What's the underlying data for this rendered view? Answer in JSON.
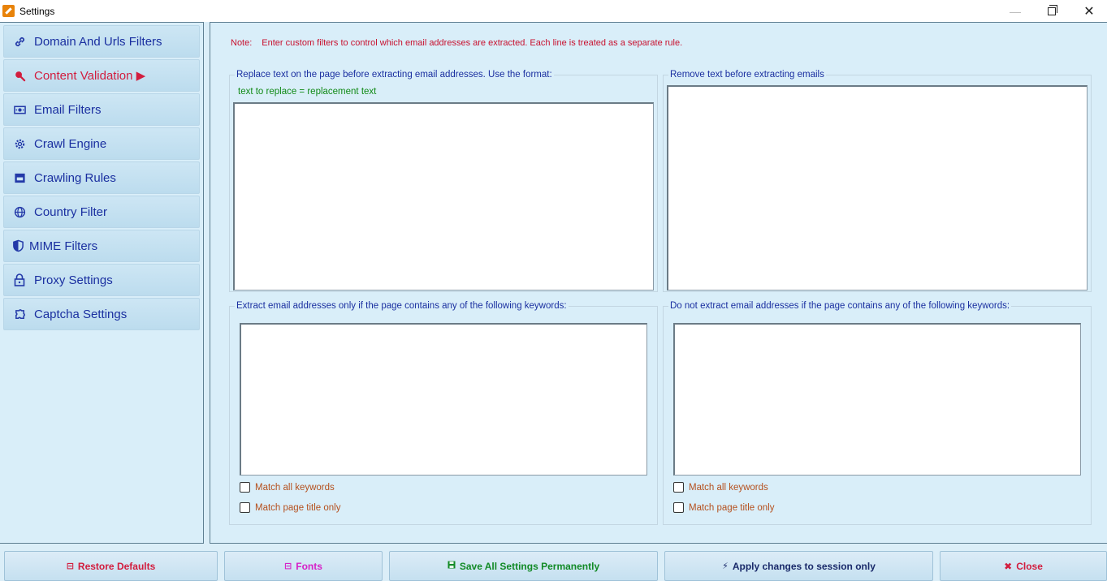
{
  "window": {
    "title": "Settings",
    "minimize_glyph": "—",
    "close_glyph": "✕"
  },
  "sidebar": {
    "items": [
      {
        "label": "Domain And Urls Filters",
        "icon": "link-icon",
        "glyph": "🔗"
      },
      {
        "label": "Content Validation ▶",
        "icon": "search-icon",
        "glyph": "🔍",
        "active": true
      },
      {
        "label": "Email Filters",
        "icon": "email-filter-icon",
        "glyph": "✉"
      },
      {
        "label": "Crawl Engine",
        "icon": "gear-icon",
        "glyph": "⚙"
      },
      {
        "label": "Crawling Rules",
        "icon": "rules-icon",
        "glyph": "▣"
      },
      {
        "label": "Country Filter",
        "icon": "globe-icon",
        "glyph": "🌐"
      },
      {
        "label": "MIME Filters",
        "icon": "shield-icon",
        "glyph": "◐"
      },
      {
        "label": "Proxy Settings",
        "icon": "lock-icon",
        "glyph": "🔒"
      },
      {
        "label": "Captcha Settings",
        "icon": "puzzle-icon",
        "glyph": "✱"
      }
    ]
  },
  "main": {
    "note_label": "Note:",
    "note_text": "Enter custom filters to control which email addresses are extracted. Each line is treated as a separate rule.",
    "replace_group": {
      "title": "Replace text on the page before extracting email addresses. Use the format:",
      "format_hint": "text to replace = replacement text",
      "value": ""
    },
    "remove_group": {
      "title": "Remove text before extracting emails",
      "value": ""
    },
    "include_group": {
      "title": "Extract email addresses only if the page contains any of the following keywords:",
      "value": "",
      "match_all_label": "Match all keywords",
      "match_title_label": "Match page title only"
    },
    "exclude_group": {
      "title": "Do not extract email addresses if the page contains any of the following keywords:",
      "value": "",
      "match_all_label": "Match all keywords",
      "match_title_label": "Match page title only"
    }
  },
  "footer": {
    "restore_label": "Restore Defaults",
    "restore_glyph": "⊟",
    "fonts_label": "Fonts",
    "fonts_glyph": "⊟",
    "save_label": "Save All Settings Permanently",
    "save_glyph": "💾",
    "apply_label": "Apply changes to session only",
    "apply_glyph": "⚡",
    "close_label": "Close",
    "close_glyph": "✖"
  },
  "colors": {
    "background": "#dbeef8",
    "nav_text": "#1a2fa0",
    "active_text": "#d21d3e",
    "note_text": "#c8102e",
    "hint_text": "#118a17",
    "checkbox_text": "#b5501e"
  }
}
